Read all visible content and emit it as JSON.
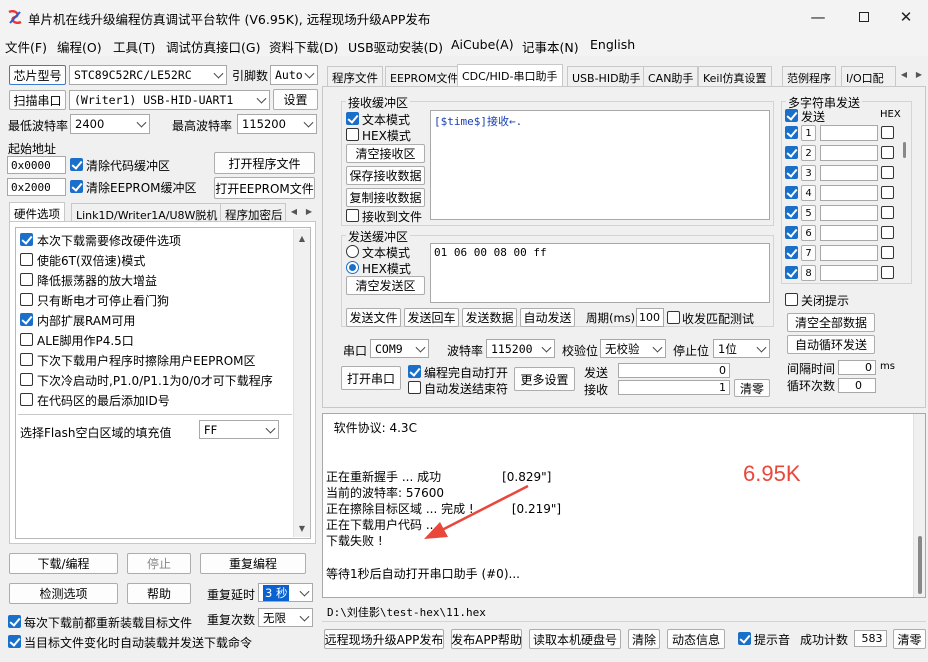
{
  "window": {
    "title": "单片机在线升级编程仿真调试平台软件 (V6.95K), 远程现场升级APP发布"
  },
  "menu": [
    "文件(F)",
    "编程(O)",
    "工具(T)",
    "调试仿真接口(G)",
    "资料下载(D)",
    "USB驱动安装(D)",
    "AiCube(A)",
    "记事本(N)",
    "English"
  ],
  "left": {
    "chip_btn": "芯片型号",
    "chip_value": "STC89C52RC/LE52RC",
    "pins_label": "引脚数",
    "pins_value": "Auto",
    "scan_btn": "扫描串口",
    "port_value": "(Writer1) USB-HID-UART1",
    "settings_btn": "设置",
    "min_baud_label": "最低波特率",
    "min_baud_value": "2400",
    "max_baud_label": "最高波特率",
    "max_baud_value": "115200",
    "start_addr_label": "起始地址",
    "addr1": "0x0000",
    "clear_code_label": "清除代码缓冲区",
    "open_prog_btn": "打开程序文件",
    "addr2": "0x2000",
    "clear_eeprom_label": "清除EEPROM缓冲区",
    "open_eeprom_btn": "打开EEPROM文件",
    "tabs": [
      "硬件选项",
      "Link1D/Writer1A/U8W脱机",
      "程序加密后"
    ],
    "options": [
      {
        "label": "本次下载需要修改硬件选项",
        "checked": true
      },
      {
        "label": "使能6T(双倍速)模式",
        "checked": false
      },
      {
        "label": "降低振荡器的放大增益",
        "checked": false
      },
      {
        "label": "只有断电才可停止看门狗",
        "checked": false
      },
      {
        "label": "内部扩展RAM可用",
        "checked": true
      },
      {
        "label": "ALE脚用作P4.5口",
        "checked": false
      },
      {
        "label": "下次下载用户程序时擦除用户EEPROM区",
        "checked": false
      },
      {
        "label": "下次冷启动时,P1.0/P1.1为0/0才可下载程序",
        "checked": false
      },
      {
        "label": "在代码区的最后添加ID号",
        "checked": false
      }
    ],
    "fill_label": "选择Flash空白区域的填充值",
    "fill_value": "FF",
    "download_btn": "下载/编程",
    "stop_btn": "停止",
    "reprog_btn": "重复编程",
    "check_btn": "检测选项",
    "help_btn": "帮助",
    "repeat_delay_label": "重复延时",
    "repeat_delay_value": "3 秒",
    "repeat_count_label": "重复次数",
    "repeat_count_value": "无限",
    "reload_label": "每次下载前都重新装载目标文件",
    "auto_label": "当目标文件变化时自动装载并发送下载命令"
  },
  "right_tabs": [
    "程序文件",
    "EEPROM文件",
    "CDC/HID-串口助手",
    "USB-HID助手",
    "CAN助手",
    "Keil仿真设置",
    "范例程序",
    "I/O口配"
  ],
  "rx": {
    "title": "接收缓冲区",
    "text_mode": "文本模式",
    "hex_mode": "HEX模式",
    "clear_btn": "清空接收区",
    "save_btn": "保存接收数据",
    "copy_btn": "复制接收数据",
    "to_file": "接收到文件",
    "content": "[$time$]接收←."
  },
  "tx": {
    "title": "发送缓冲区",
    "text_mode": "文本模式",
    "hex_mode": "HEX模式",
    "clear_btn": "清空发送区",
    "content": "01 06 00 08 00 ff",
    "send_file_btn": "发送文件",
    "send_cr_btn": "发送回车",
    "send_data_btn": "发送数据",
    "auto_send_btn": "自动发送",
    "period_label": "周期(ms)",
    "period_value": "100",
    "match_label": "收发匹配测试"
  },
  "serial": {
    "port_label": "串口",
    "port_value": "COM9",
    "baud_label": "波特率",
    "baud_value": "115200",
    "parity_label": "校验位",
    "parity_value": "无校验",
    "stop_label": "停止位",
    "stop_value": "1位",
    "open_btn": "打开串口",
    "auto_open_label": "编程完自动打开",
    "auto_end_label": "自动发送结束符",
    "more_btn": "更多设置",
    "send_label": "发送",
    "send_count": "0",
    "recv_label": "接收",
    "recv_count": "1",
    "clear_btn": "清零"
  },
  "multi": {
    "title": "多字符串发送",
    "send_header": "发送",
    "hex_header": "HEX",
    "rows": [
      "1",
      "2",
      "3",
      "4",
      "5",
      "6",
      "7",
      "8"
    ],
    "close_tip_label": "关闭提示",
    "clear_all_btn": "清空全部数据",
    "auto_loop_btn": "自动循环发送",
    "interval_label": "间隔时间",
    "interval_value": "0",
    "interval_unit": "ms",
    "loop_label": "循环次数",
    "loop_value": "0"
  },
  "log": {
    "lines": [
      "  软件协议: 4.3C",
      "",
      "",
      "正在重新握手 ... 成功                [0.829\"]",
      "当前的波特率: 57600",
      "正在擦除目标区域 ... 完成 !          [0.219\"]",
      "正在下载用户代码 ...",
      "下载失败 !",
      "",
      "等待1秒后自动打开串口助手 (#0)..."
    ],
    "annotation": "6.95K",
    "annotation_color": "#e8473a"
  },
  "path": "D:\\刘佳影\\test-hex\\11.hex",
  "bottom": {
    "remote_btn": "远程现场升级APP发布",
    "app_help_btn": "发布APP帮助",
    "read_disk_btn": "读取本机硬盘号",
    "clear_btn": "清除",
    "dyn_btn": "动态信息",
    "sound_label": "提示音",
    "success_label": "成功计数",
    "success_value": "583",
    "reset_btn": "清零"
  }
}
